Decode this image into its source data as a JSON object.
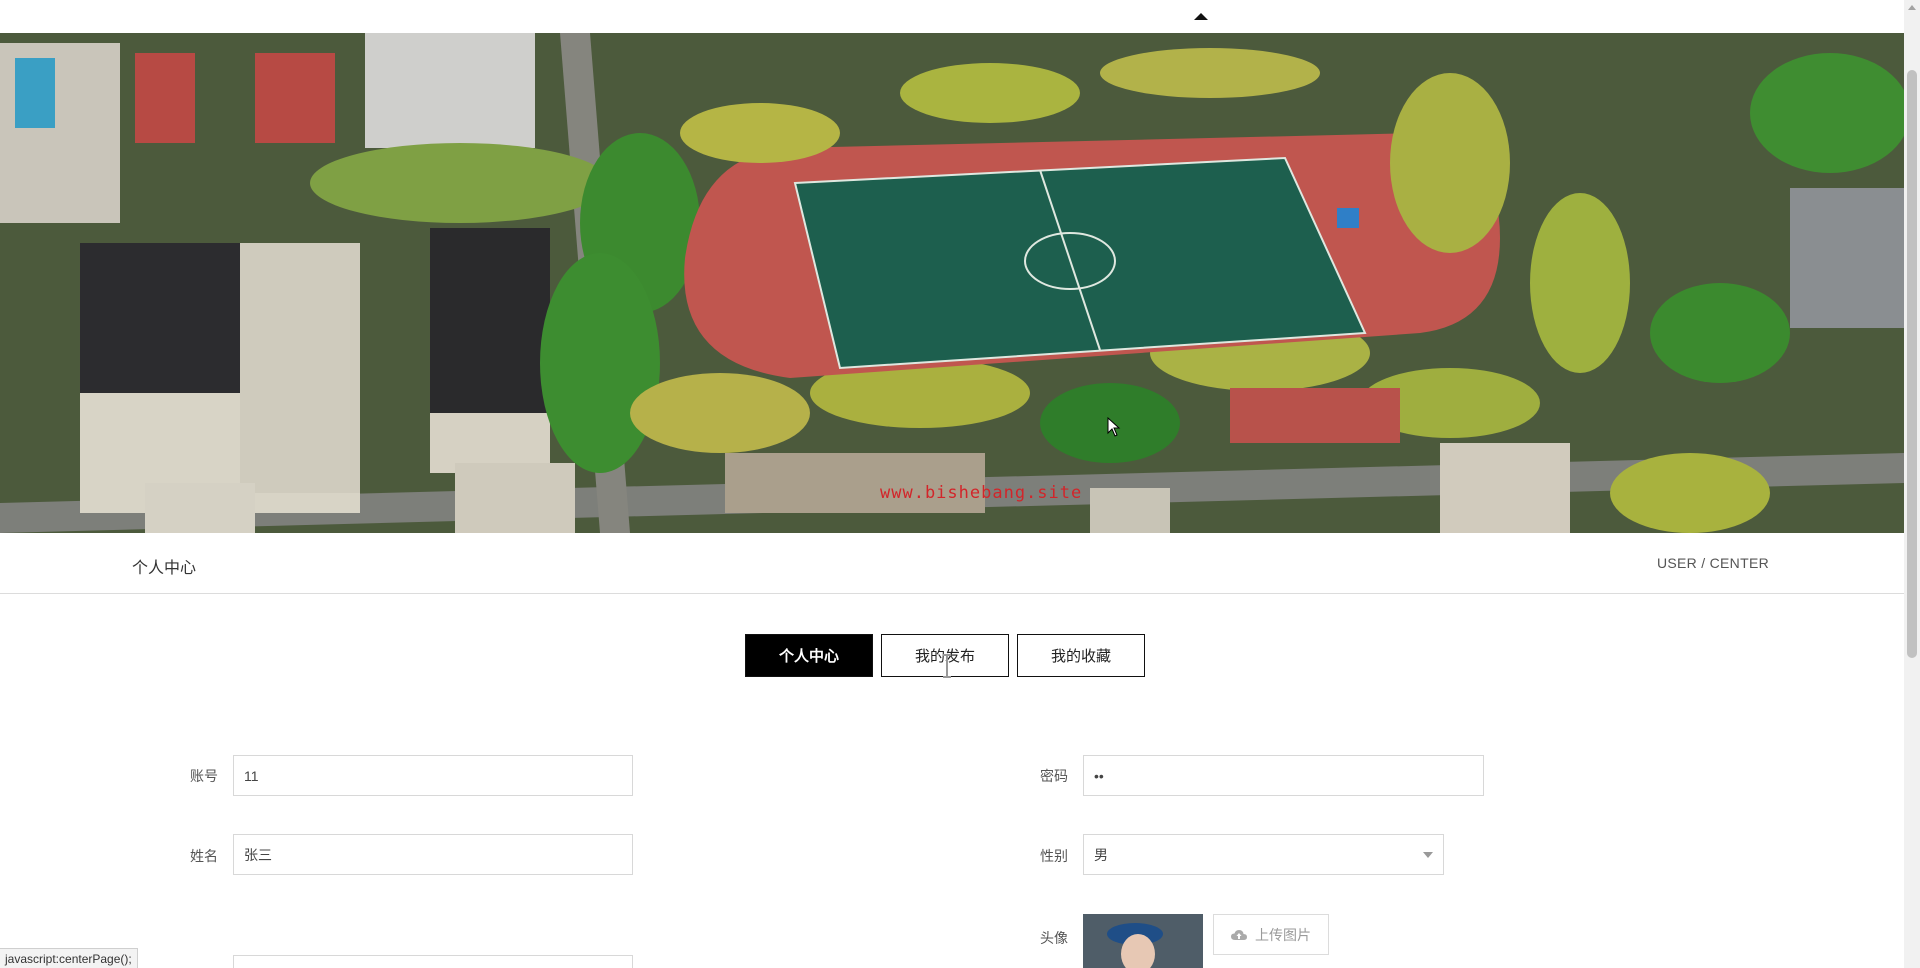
{
  "banner": {
    "watermark": "www.bishebang.site",
    "image_alt": "campus-aerial-photo"
  },
  "section": {
    "title": "个人中心",
    "subtitle": "USER / CENTER"
  },
  "tabs": [
    {
      "label": "个人中心",
      "active": true
    },
    {
      "label": "我的发布",
      "active": false
    },
    {
      "label": "我的收藏",
      "active": false
    }
  ],
  "form": {
    "account": {
      "label": "账号",
      "value": "11"
    },
    "password": {
      "label": "密码",
      "value": "••"
    },
    "name": {
      "label": "姓名",
      "value": "张三"
    },
    "gender": {
      "label": "性别",
      "value": "男"
    },
    "avatar": {
      "label": "头像",
      "upload_label": "上传图片"
    }
  },
  "status_bar": {
    "text": "javascript:centerPage();"
  },
  "colors": {
    "active_tab": "#000000",
    "watermark": "#d2252a",
    "track": "#c0564f",
    "field": "#1d5f4e"
  }
}
